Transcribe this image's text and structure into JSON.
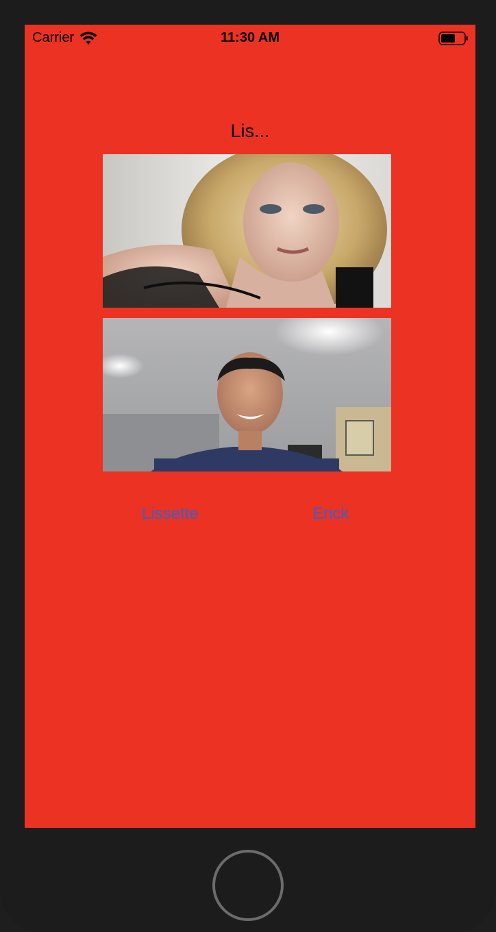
{
  "status_bar": {
    "carrier": "Carrier",
    "time": "11:30 AM",
    "wifi_icon": "wifi-icon",
    "battery_icon": "battery-icon"
  },
  "main": {
    "title": "Lis...",
    "buttons": {
      "left_label": "Lissette",
      "right_label": "Erick"
    }
  },
  "colors": {
    "screen_background": "#ec3222",
    "button_text": "#3a60c9",
    "device_bezel": "#1c1c1c"
  }
}
